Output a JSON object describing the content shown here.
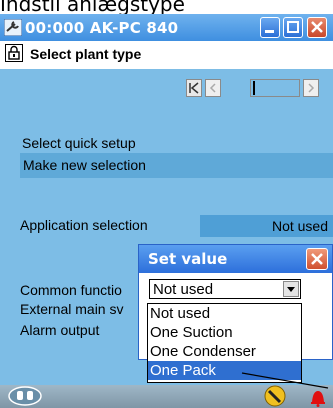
{
  "page": {
    "heading": "Indstil anlægstype"
  },
  "window": {
    "title": "00:000 AK-PC 840"
  },
  "header": {
    "title": "Select plant type"
  },
  "content": {
    "quick_setup_label": "Select quick setup",
    "selection_value": "Make new selection",
    "application_label": "Application selection",
    "application_value": "Not used",
    "common_functions_label": "Common functio",
    "external_main_switch_label": "External main sv",
    "alarm_output_label": "Alarm output"
  },
  "dialog": {
    "title": "Set value",
    "current_value": "Not used",
    "options": [
      "Not used",
      "One Suction",
      "One Condenser",
      "One Pack"
    ],
    "selected_index": 3
  },
  "colors": {
    "content_bg": "#7dbde6",
    "selection_bar": "#5fa9d8",
    "titlebar": "#3f8fe0",
    "highlight": "#2f6fd0",
    "alarm": "#e01010"
  },
  "icons": {
    "title": "wrench-icon",
    "lock": "lock-icon",
    "status_left": "network-icon",
    "tool": "tool-icon",
    "alarm": "alarm-bell-icon"
  }
}
